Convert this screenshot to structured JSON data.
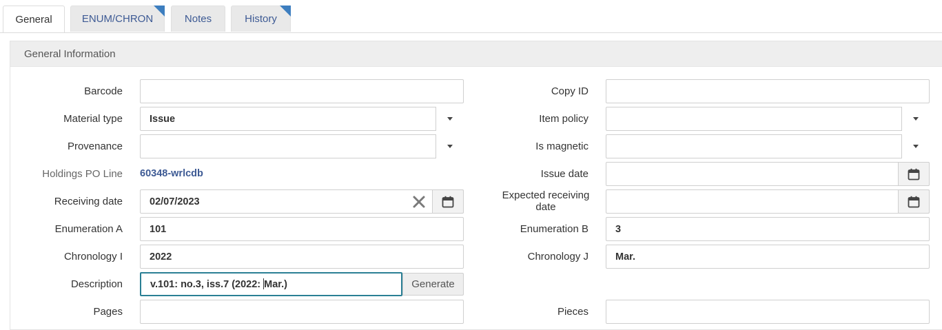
{
  "tabs": [
    {
      "label": "General",
      "active": true,
      "has_marker": false
    },
    {
      "label": "ENUM/CHRON",
      "active": false,
      "has_marker": true
    },
    {
      "label": "Notes",
      "active": false,
      "has_marker": false
    },
    {
      "label": "History",
      "active": false,
      "has_marker": true
    }
  ],
  "section": {
    "title": "General Information"
  },
  "form": {
    "left": {
      "barcode": {
        "label": "Barcode",
        "value": ""
      },
      "material_type": {
        "label": "Material type",
        "value": "Issue"
      },
      "provenance": {
        "label": "Provenance",
        "value": ""
      },
      "holdings_po_line": {
        "label": "Holdings PO Line",
        "value": "60348-wrlcdb"
      },
      "receiving_date": {
        "label": "Receiving date",
        "value": "02/07/2023"
      },
      "enumeration_a": {
        "label": "Enumeration A",
        "value": "101"
      },
      "chronology_i": {
        "label": "Chronology I",
        "value": "2022"
      },
      "description": {
        "label": "Description",
        "value_before_cursor": "v.101: no.3, iss.7 (2022: ",
        "value_after_cursor": "Mar.)",
        "button": "Generate"
      },
      "pages": {
        "label": "Pages",
        "value": ""
      }
    },
    "right": {
      "copy_id": {
        "label": "Copy ID",
        "value": ""
      },
      "item_policy": {
        "label": "Item policy",
        "value": ""
      },
      "is_magnetic": {
        "label": "Is magnetic",
        "value": ""
      },
      "issue_date": {
        "label": "Issue date",
        "value": ""
      },
      "expected_receiving_date": {
        "label_line1": "Expected receiving",
        "label_line2": "date",
        "value": ""
      },
      "enumeration_b": {
        "label": "Enumeration B",
        "value": "3"
      },
      "chronology_j": {
        "label": "Chronology J",
        "value": "Mar."
      },
      "pieces": {
        "label": "Pieces",
        "value": ""
      }
    }
  },
  "colors": {
    "accent": "#3d5a94",
    "tab_marker": "#3d7ebf",
    "focus_border": "#2a7f94"
  },
  "icons": {
    "dropdown": "caret-down-icon",
    "calendar": "calendar-icon",
    "clear": "clear-x-icon"
  }
}
